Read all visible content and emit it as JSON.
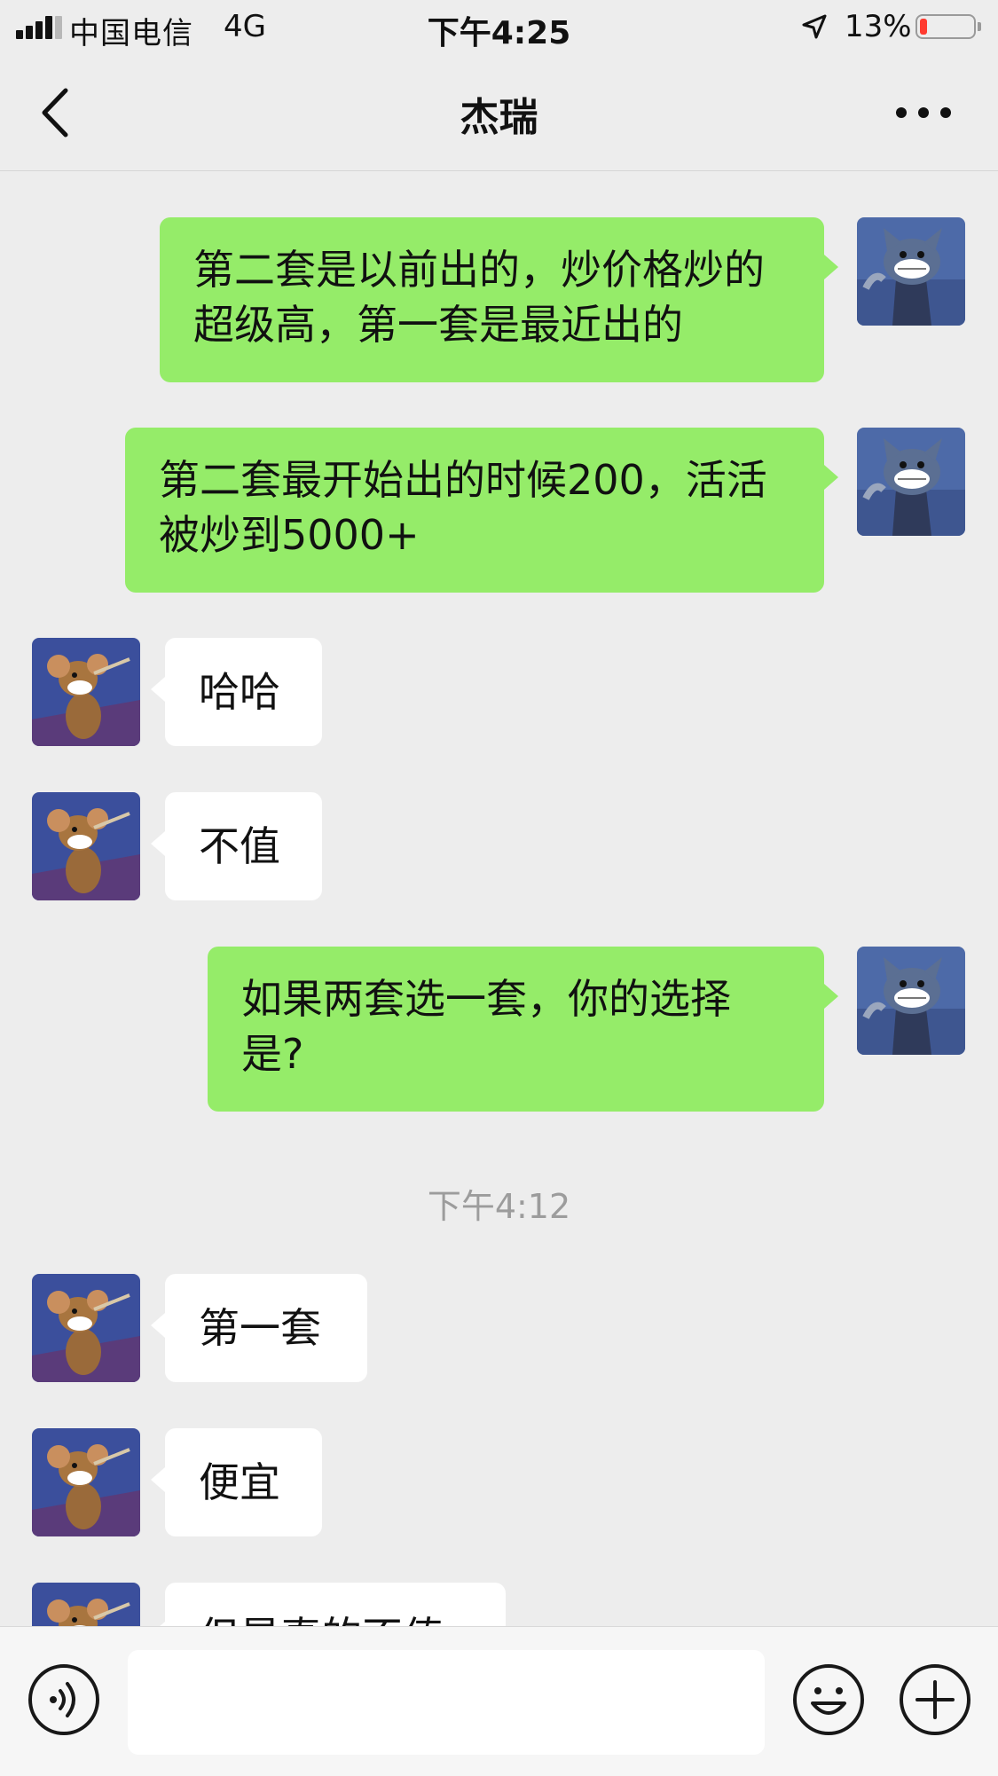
{
  "status_bar": {
    "carrier": "中国电信",
    "network": "4G",
    "time": "下午4:25",
    "battery": "13%",
    "battery_level": 0.13,
    "battery_color": "#ff3b30"
  },
  "nav": {
    "title": "杰瑞",
    "back_icon": "chevron-left-icon",
    "more_icon": "more-dots-icon"
  },
  "messages": [
    {
      "side": "out",
      "text": "第二套是以前出的，炒价格炒的超级高，第一套是最近出的"
    },
    {
      "side": "out",
      "text": "第二套最开始出的时候200，活活被炒到5000+"
    },
    {
      "side": "in",
      "text": "哈哈"
    },
    {
      "side": "in",
      "text": "不值"
    },
    {
      "side": "out",
      "text": "如果两套选一套，你的选择是?"
    },
    {
      "side": "in",
      "text": "第一套"
    },
    {
      "side": "in",
      "text": "便宜"
    },
    {
      "side": "in",
      "text": "但是真的不值"
    }
  ],
  "timestamp": "下午4:12",
  "colors": {
    "outgoing_bubble": "#95ec69",
    "incoming_bubble": "#ffffff",
    "background": "#ededed"
  },
  "input_bar": {
    "voice_icon": "voice-icon",
    "emoji_icon": "emoji-icon",
    "plus_icon": "plus-icon",
    "input_value": ""
  }
}
